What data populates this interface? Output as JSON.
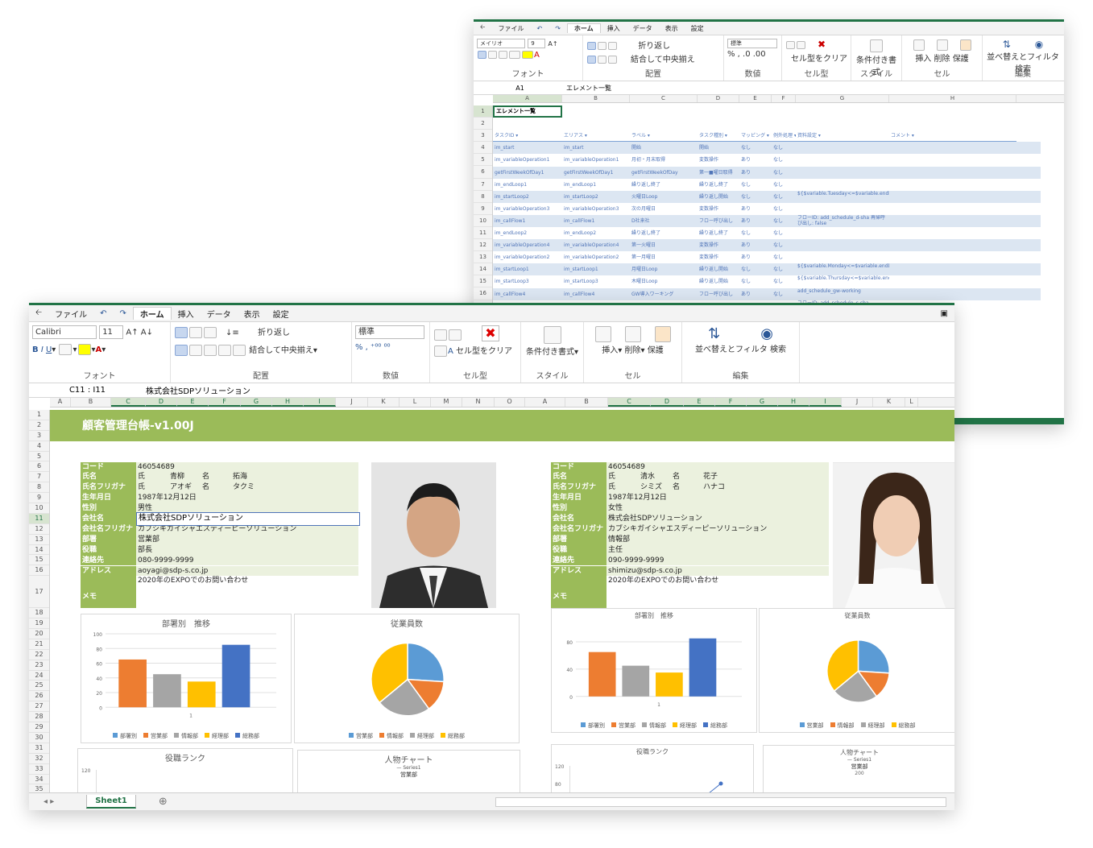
{
  "back": {
    "tabs": [
      "ファイル",
      "ホーム",
      "挿入",
      "データ",
      "表示",
      "設定"
    ],
    "font": {
      "name": "メイリオ",
      "size": "9"
    },
    "groups": {
      "font": "フォント",
      "align": "配置",
      "number": "数値",
      "cellstyle": "セル型",
      "style": "スタイル",
      "cell": "セル",
      "edit": "編集"
    },
    "wrap": "折り返し",
    "merge": "結合して中央揃え",
    "numfmt": "標準",
    "clear": "セル型をクリア",
    "cond": "条件付き書式",
    "insert": "挿入",
    "delete": "削除",
    "protect": "保護",
    "sort": "並べ替えとフィルタ",
    "find": "検索",
    "cellref": "A1",
    "formula": "エレメント一覧",
    "cols": [
      "A",
      "B",
      "C",
      "D",
      "E",
      "F",
      "G",
      "H"
    ],
    "title": "エレメント一覧",
    "headers": [
      "タスクID",
      "エリアス",
      "ラベル",
      "タスク種別",
      "マッピング",
      "例外処理",
      "資料設定",
      "コメント"
    ],
    "rows": [
      [
        "im_start",
        "im_start",
        "開始",
        "開始",
        "なし",
        "なし",
        ""
      ],
      [
        "im_variableOperation1",
        "im_variableOperation1",
        "月初・月末取得",
        "変数操作",
        "あり",
        "なし",
        ""
      ],
      [
        "getFirstWeekOfDay1",
        "getFirstWeekOfDay1",
        "getFirstWeekOfDay",
        "第一■曜日取得",
        "あり",
        "なし",
        ""
      ],
      [
        "im_endLoop1",
        "im_endLoop1",
        "繰り返し終了",
        "繰り返し終了",
        "なし",
        "なし",
        ""
      ],
      [
        "im_startLoop2",
        "im_startLoop2",
        "火曜日Loop",
        "繰り返し開始",
        "なし",
        "なし",
        "${$variable.Tuesday<=$variable.endDayOfMonth}"
      ],
      [
        "im_variableOperation3",
        "im_variableOperation3",
        "次の月曜日",
        "変数操作",
        "あり",
        "なし",
        ""
      ],
      [
        "im_callFlow1",
        "im_callFlow1",
        "D社来社",
        "フロー呼び出し",
        "あり",
        "なし",
        "フローID: add_schedule_d-sha 再帰呼び出し: false"
      ],
      [
        "im_endLoop2",
        "im_endLoop2",
        "繰り返し終了",
        "繰り返し終了",
        "なし",
        "なし",
        ""
      ],
      [
        "im_variableOperation4",
        "im_variableOperation4",
        "第一火曜日",
        "変数操作",
        "あり",
        "なし",
        ""
      ],
      [
        "im_variableOperation2",
        "im_variableOperation2",
        "第一月曜日",
        "変数操作",
        "あり",
        "なし",
        ""
      ],
      [
        "im_startLoop1",
        "im_startLoop1",
        "月曜日Loop",
        "繰り返し開始",
        "なし",
        "なし",
        "${$variable.Monday<=$variable.endDayOfMonth}"
      ],
      [
        "im_startLoop3",
        "im_startLoop3",
        "木曜日Loop",
        "繰り返し開始",
        "なし",
        "なし",
        "${$variable.Thursday<=$variable.endDayOfMonth}"
      ],
      [
        "im_callFlow4",
        "im_callFlow4",
        "GW導入ワーキング",
        "フロー呼び出し",
        "あり",
        "なし",
        "add_schedule_gw-working"
      ],
      [
        "im_callFlow3",
        "im_callFlow3",
        "C社来社",
        "フロー呼び出し",
        "あり",
        "なし",
        "フローID: add_schedule_c-sha"
      ]
    ]
  },
  "front": {
    "tabs": [
      "ファイル",
      "ホーム",
      "挿入",
      "データ",
      "表示",
      "設定"
    ],
    "font": {
      "name": "Calibri",
      "size": "11"
    },
    "groups": {
      "font": "フォント",
      "align": "配置",
      "number": "数値",
      "cellstyle": "セル型",
      "style": "スタイル",
      "cell": "セル",
      "edit": "編集"
    },
    "wrap": "折り返し",
    "merge": "結合して中央揃え",
    "numfmt": "標準",
    "clear": "セル型をクリア",
    "cond": "条件付き書式",
    "insert": "挿入",
    "delete": "削除",
    "protect": "保護",
    "sort": "並べ替えとフィルタ",
    "find": "検索",
    "cellref": "C11 : I11",
    "formula": "株式会社SDPソリューション",
    "cols": [
      "A",
      "B",
      "C",
      "D",
      "E",
      "F",
      "G",
      "H",
      "I",
      "J",
      "K",
      "L",
      "M",
      "N",
      "O",
      "A",
      "B",
      "C",
      "D",
      "E",
      "F",
      "G",
      "H",
      "I",
      "J",
      "K",
      "L"
    ],
    "banner": "顧客管理台帳-v1.00J",
    "sheet": "Sheet1",
    "labels": [
      "コード",
      "氏名",
      "氏名フリガナ",
      "生年月日",
      "性別",
      "会社名",
      "会社名フリガナ",
      "部署",
      "役職",
      "連絡先",
      "アドレス",
      "メモ"
    ],
    "sei": "氏",
    "mei": "名",
    "person1": {
      "code": "46054689",
      "sei": "青柳",
      "mei": "拓海",
      "sei_kana": "アオギ",
      "mei_kana": "タクミ",
      "birth": "1987年12月12日",
      "gender": "男性",
      "company": "株式会社SDPソリューション",
      "company_kana": "カブシキガイシャエスディーピーソリューション",
      "dept": "営業部",
      "title": "部長",
      "tel": "080-9999-9999",
      "mail": "aoyagi@sdp-s.co.jp",
      "memo": "2020年のEXPOでのお問い合わせ"
    },
    "person2": {
      "code": "46054689",
      "sei": "清水",
      "mei": "花子",
      "sei_kana": "シミズ",
      "mei_kana": "ハナコ",
      "birth": "1987年12月12日",
      "gender": "女性",
      "company": "株式会社SDPソリューション",
      "company_kana": "カブシキガイシャエスディーピーソリューション",
      "dept": "情報部",
      "title": "主任",
      "tel": "090-9999-9999",
      "mail": "shimizu@sdp-s.co.jp",
      "memo": "2020年のEXPOでのお問い合わせ"
    },
    "chart_data": [
      {
        "type": "bar",
        "title": "部署別　推移",
        "categories": [
          "1"
        ],
        "series": [
          {
            "name": "部署別",
            "values": [
              0
            ]
          },
          {
            "name": "営業部",
            "values": [
              65
            ]
          },
          {
            "name": "情報部",
            "values": [
              45
            ]
          },
          {
            "name": "経理部",
            "values": [
              35
            ]
          },
          {
            "name": "総務部",
            "values": [
              85
            ]
          }
        ],
        "ylim": [
          0,
          100
        ],
        "yticks": [
          "0",
          "20",
          "40",
          "60",
          "80",
          "100"
        ],
        "colors": [
          "#5b9bd5",
          "#ed7d31",
          "#a5a5a5",
          "#ffc000",
          "#4472c4"
        ]
      },
      {
        "type": "pie",
        "title": "従業員数",
        "categories": [
          "営業部",
          "情報部",
          "経理部",
          "総務部"
        ],
        "values": [
          26,
          14,
          24,
          36
        ],
        "colors": [
          "#5b9bd5",
          "#ed7d31",
          "#a5a5a5",
          "#ffc000"
        ]
      },
      {
        "type": "line",
        "title": "役職ランク",
        "ylim": [
          0,
          120
        ],
        "ytick": "120"
      },
      {
        "type": "radar",
        "title": "人物チャート",
        "series": [
          {
            "name": "Series1"
          }
        ],
        "axis_label": "営業部"
      }
    ],
    "chart2_y": [
      "0",
      "40",
      "80"
    ],
    "rank2_y": [
      "120",
      "80"
    ],
    "radar2_tick": "200"
  }
}
